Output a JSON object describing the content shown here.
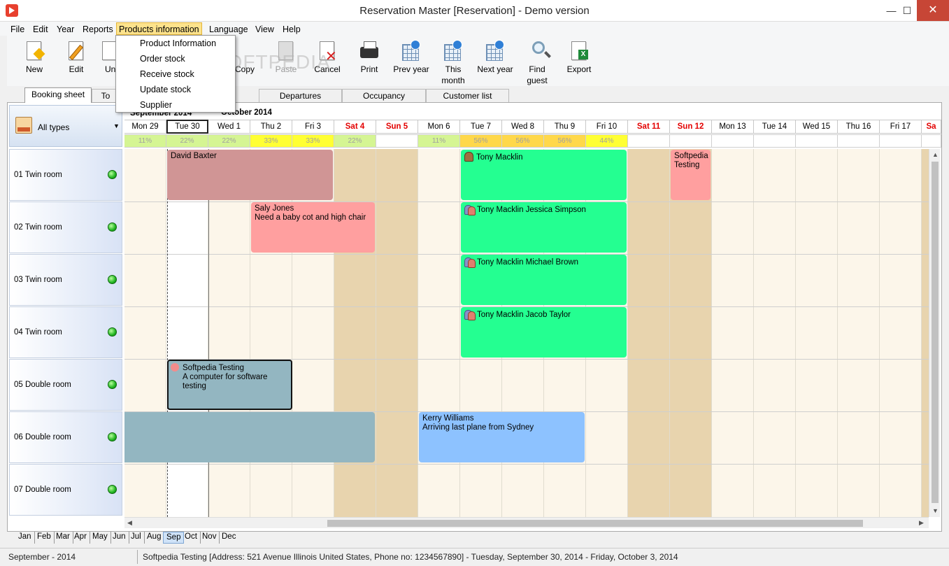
{
  "window": {
    "title": "Reservation Master [Reservation] - Demo version",
    "minimize": "—",
    "maximize": "☐",
    "close": "✕"
  },
  "menu": [
    "File",
    "Edit",
    "Year",
    "Reports",
    "Products information",
    "Language",
    "View",
    "Help"
  ],
  "products_menu": [
    "Product Information",
    "Order stock",
    "Receive stock",
    "Update stock",
    "Supplier"
  ],
  "toolbar": {
    "new": "New",
    "edit": "Edit",
    "un": "Un",
    "copy": "Copy",
    "paste": "Paste",
    "cancel": "Cancel",
    "print": "Print",
    "prev_year": "Prev year",
    "this_month_1": "This",
    "this_month_2": "month",
    "next_year": "Next year",
    "find_guest_1": "Find",
    "find_guest_2": "guest",
    "export": "Export"
  },
  "watermark": "SOFTPEDIA",
  "tabs": [
    "Booking sheet",
    "To",
    "Departures",
    "Occupancy",
    "Customer list"
  ],
  "filter": {
    "label": "All types",
    "arrow": "▼"
  },
  "months_header": [
    "September 2014",
    "October 2014"
  ],
  "days": [
    "Mon 29",
    "Tue 30",
    "Wed 1",
    "Thu 2",
    "Fri 3",
    "Sat 4",
    "Sun 5",
    "Mon 6",
    "Tue 7",
    "Wed 8",
    "Thu 9",
    "Fri 10",
    "Sat 11",
    "Sun 12",
    "Mon 13",
    "Tue 14",
    "Wed 15",
    "Thu 16",
    "Fri 17",
    "Sa"
  ],
  "occupancy": [
    "11%",
    "22%",
    "22%",
    "33%",
    "33%",
    "22%",
    "",
    "11%",
    "56%",
    "56%",
    "56%",
    "44%",
    "",
    "",
    "",
    "",
    "",
    "",
    "",
    ""
  ],
  "colors": {
    "occ_green": "#d5f593",
    "occ_yellow": "#ffff33",
    "occ_gold": "#ffd84a",
    "weekend": "#e8d4ae",
    "weekday": "#fcf6ea"
  },
  "rooms": [
    "01  Twin room",
    "02  Twin room",
    "03  Twin room",
    "04  Twin room",
    "05  Double room",
    "06  Double room",
    "07  Double room"
  ],
  "bookings": {
    "b1": {
      "name": "David Baxter",
      "color": "#d09595"
    },
    "b2": {
      "name": "Tony Macklin",
      "color": "#24ff91"
    },
    "b3": {
      "name": "Softpedia Testing",
      "color": "#ff9f9f"
    },
    "b4": {
      "name": "Saly Jones",
      "note": "Need a baby cot and high chair",
      "color": "#ff9f9f"
    },
    "b5": {
      "name": "Tony Macklin Jessica Simpson",
      "color": "#24ff91"
    },
    "b6": {
      "name": "Tony Macklin Michael Brown",
      "color": "#24ff91"
    },
    "b7": {
      "name": "Tony Macklin Jacob Taylor",
      "color": "#24ff91"
    },
    "b8": {
      "name": "Softpedia Testing",
      "note": "A computer for software testing",
      "color": "#93b6c1"
    },
    "b9": {
      "color": "#93b6c1"
    },
    "b10": {
      "name": "Kerry Williams",
      "note": "Arriving last plane from Sydney",
      "color": "#8dc2ff"
    }
  },
  "month_tabs": [
    "Jan",
    "Feb",
    "Mar",
    "Apr",
    "May",
    "Jun",
    "Jul",
    "Aug",
    "Sep",
    "Oct",
    "Nov",
    "Dec"
  ],
  "selected_month": "Sep",
  "status": {
    "left": "September - 2014",
    "right": "Softpedia Testing [Address: 521 Avenue Illinois United States, Phone no: 1234567890] - Tuesday, September 30, 2014 - Friday, October 3, 2014"
  }
}
